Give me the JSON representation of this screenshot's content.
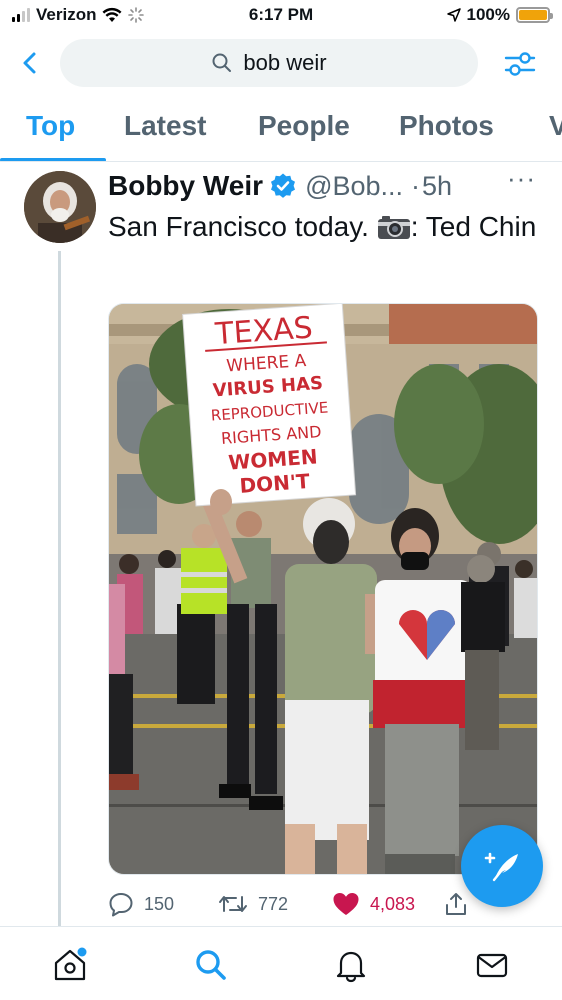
{
  "status_bar": {
    "carrier": "Verizon",
    "time": "6:17 PM",
    "battery": "100%",
    "battery_level": 1.0,
    "icons": [
      "signal-icon",
      "wifi-icon",
      "activity-spinner-icon",
      "location-arrow-icon",
      "battery-icon"
    ]
  },
  "search": {
    "query": "bob weir",
    "back_icon": "chevron-left-icon",
    "search_icon": "search-icon",
    "filter_icon": "filter-sliders-icon"
  },
  "tabs": [
    {
      "label": "Top",
      "active": true
    },
    {
      "label": "Latest",
      "active": false
    },
    {
      "label": "People",
      "active": false
    },
    {
      "label": "Photos",
      "active": false
    },
    {
      "label": "V",
      "active": false
    }
  ],
  "tweet": {
    "author_name": "Bobby Weir",
    "handle": "@Bob...",
    "separator": "·",
    "time": "5h",
    "more": "···",
    "text_before": "San Francisco today. ",
    "text_after": ": Ted Chin",
    "photo": {
      "sign_lines": [
        "TEXAS",
        "WHERE A",
        "VIRUS HAS",
        "REPRODUCTIVE",
        "RIGHTS AND",
        "WOMEN",
        "DON'T"
      ]
    },
    "stats": {
      "replies": "150",
      "retweets": "772",
      "likes": "4,083"
    }
  },
  "colors": {
    "accent": "#1d9bf0",
    "like": "#c8164f",
    "secondary_text": "#536471",
    "battery": "#f0a30a"
  },
  "bottom_nav": [
    {
      "name": "home-icon",
      "active": false
    },
    {
      "name": "search-icon",
      "active": true
    },
    {
      "name": "notifications-bell-icon",
      "active": false
    },
    {
      "name": "messages-mail-icon",
      "active": false
    }
  ]
}
